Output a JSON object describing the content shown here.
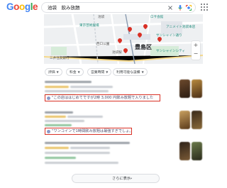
{
  "header": {
    "logo_letters": [
      {
        "ch": "G",
        "color": "#4285F4"
      },
      {
        "ch": "o",
        "color": "#EA4335"
      },
      {
        "ch": "o",
        "color": "#FBBC05"
      },
      {
        "ch": "g",
        "color": "#4285F4"
      },
      {
        "ch": "l",
        "color": "#34A853"
      },
      {
        "ch": "e",
        "color": "#EA4335"
      }
    ],
    "search_query": "池袋　飲み放題",
    "icons": [
      "close-icon",
      "mic-icon",
      "lens-icon",
      "search-icon",
      "apps-icon"
    ]
  },
  "map": {
    "ward_label": "豊島区",
    "labels": [
      "池袋",
      "ロサ会館",
      "サンシャイン通り",
      "東京芸術劇場",
      "アニメイト池袋本店",
      "サンシャインシティ",
      "西口公園",
      "池袋駅",
      "三井住友銀行"
    ],
    "zoom_in": "+",
    "zoom_out": "−"
  },
  "filters": [
    {
      "label": "評価",
      "has_dropdown": true
    },
    {
      "label": "料金",
      "has_dropdown": true
    },
    {
      "label": "営業時間",
      "has_dropdown": true
    },
    {
      "label": "利用可能な設備",
      "has_dropdown": true
    }
  ],
  "reviews": [
    {
      "text": "\"この店ははじめてですが2時 3,000 円飲み放題で入りました"
    },
    {
      "text": "\"ワンコインで1時間飲み放題は最強すぎでしょ。"
    }
  ],
  "more_button": {
    "label": "さらに表示",
    "arrow": "→"
  },
  "colors": {
    "highlight_border": "#d93025",
    "chip_border": "#dadce0",
    "review_text": "#4a4a6a"
  }
}
